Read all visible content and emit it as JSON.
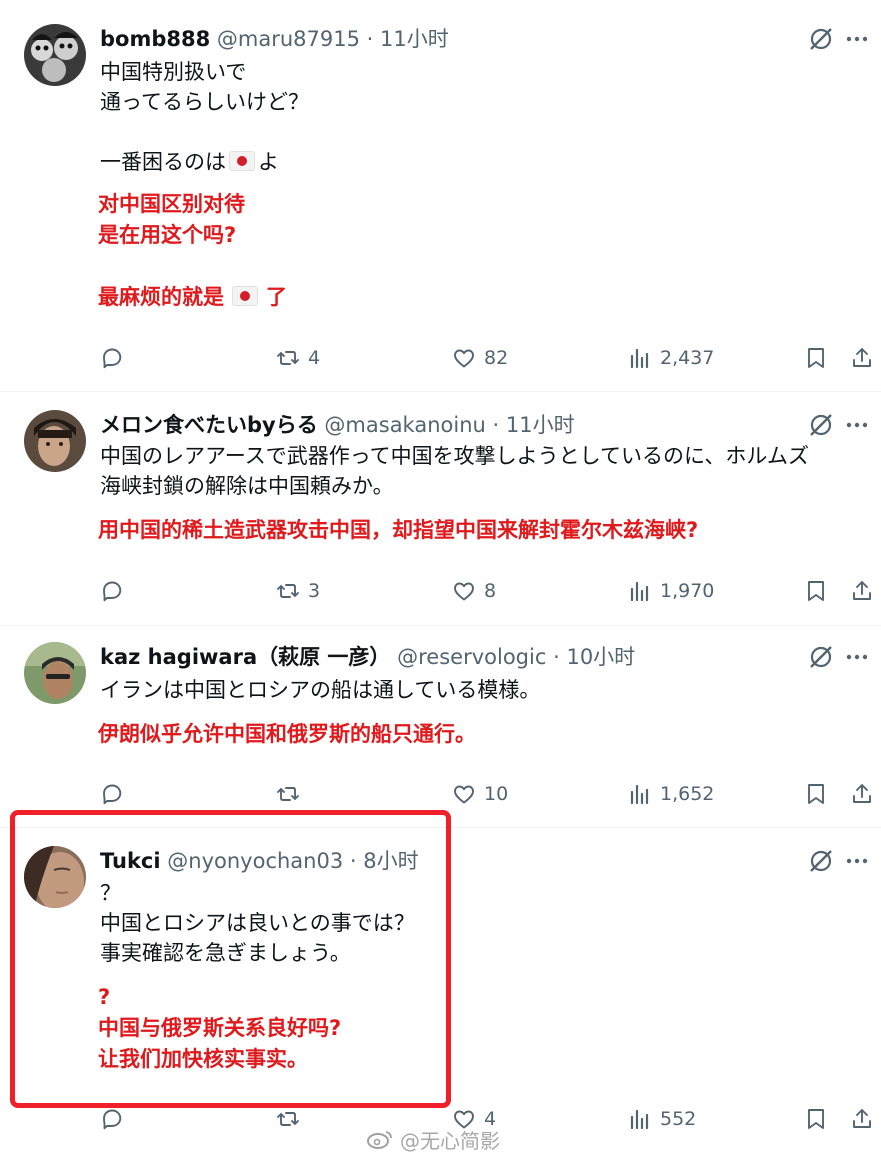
{
  "posts": [
    {
      "name": "bomb888",
      "handle": "@maru87915",
      "dot": "·",
      "time": "11小时",
      "text_lines": [
        "中国特別扱いで",
        "通ってるらしいけど？",
        "",
        "一番困るのは"
      ],
      "text_suffix": "よ",
      "trans_lines": [
        "对中国区别对待",
        "是在用这个吗?",
        ""
      ],
      "trans_last_prefix": "最麻烦的就是",
      "trans_last_suffix": "了",
      "flag_emoji": "japan-flag-icon",
      "reply_count": "",
      "repost_count": "4",
      "like_count": "82",
      "view_count": "2,437"
    },
    {
      "name": "メロン食べたいbyらる",
      "handle": "@masakanoinu",
      "dot": "·",
      "time": "11小时",
      "text_lines": [
        "中国のレアアースで武器作って中国を攻撃しようとしているのに、ホルムズ",
        "海峡封鎖の解除は中国頼みか。"
      ],
      "trans_lines": [
        "用中国的稀土造武器攻击中国，却指望中国来解封霍尔木兹海峡?"
      ],
      "reply_count": "",
      "repost_count": "3",
      "like_count": "8",
      "view_count": "1,970"
    },
    {
      "name": "kaz hagiwara（萩原 一彦）",
      "handle": "@reservologic",
      "dot": "·",
      "time": "10小时",
      "text_lines": [
        "イランは中国とロシアの船は通している模様。"
      ],
      "trans_lines": [
        "伊朗似乎允许中国和俄罗斯的船只通行。"
      ],
      "reply_count": "",
      "repost_count": "",
      "like_count": "10",
      "view_count": "1,652"
    },
    {
      "name": "Tukci",
      "handle": "@nyonyochan03",
      "dot": "·",
      "time": "8小时",
      "text_lines": [
        "？",
        "中国とロシアは良いとの事では？",
        "事実確認を急ぎましょう。"
      ],
      "trans_lines": [
        "?",
        "中国与俄罗斯关系良好吗?",
        "让我们加快核实事实。"
      ],
      "reply_count": "",
      "repost_count": "",
      "like_count": "4",
      "view_count": "552"
    }
  ],
  "watermark": "@无心简影",
  "colors": {
    "text": "#0f1419",
    "muted": "#536471",
    "translation": "#e0191c",
    "highlight_border": "#f0202a",
    "divider": "#eff3f4"
  }
}
